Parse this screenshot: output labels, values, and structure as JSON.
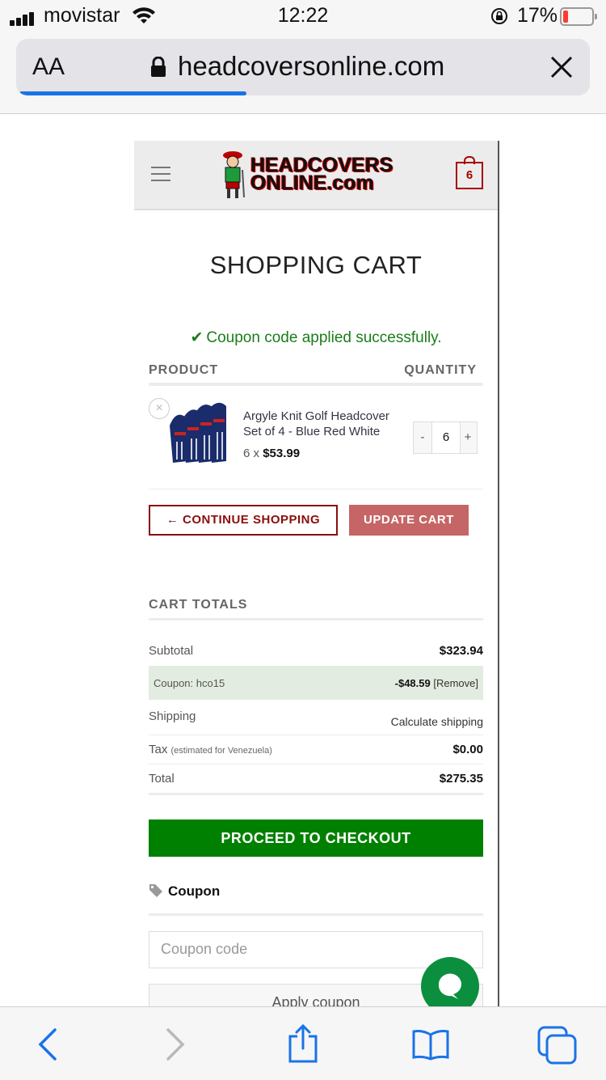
{
  "status_bar": {
    "carrier": "movistar",
    "time": "12:22",
    "battery_percent": "17%"
  },
  "browser": {
    "text_size_label": "AA",
    "url": "headcoversonline.com",
    "load_progress": 0.4
  },
  "site": {
    "logo_line1": "HEADCOVERS",
    "logo_line2": "ONLINE.com",
    "cart_count": "6"
  },
  "cart": {
    "title": "SHOPPING CART",
    "notice": "Coupon code applied successfully.",
    "col_product": "PRODUCT",
    "col_quantity": "QUANTITY",
    "item": {
      "name": "Argyle Knit Golf Headcover Set of 4 - Blue Red White",
      "qty_prefix": "6 x ",
      "price": "$53.99",
      "quantity": "6",
      "minus": "-",
      "plus": "+"
    },
    "continue_label": "← CONTINUE SHOPPING",
    "update_label": "UPDATE CART"
  },
  "totals": {
    "title": "CART TOTALS",
    "subtotal_label": "Subtotal",
    "subtotal_value": "$323.94",
    "coupon_label": "Coupon: hco15",
    "coupon_value": "-$48.59",
    "coupon_remove": "[Remove]",
    "shipping_label": "Shipping",
    "shipping_value": "Calculate shipping",
    "tax_label": "Tax",
    "tax_note": "(estimated for Venezuela)",
    "tax_value": "$0.00",
    "total_label": "Total",
    "total_value": "$275.35",
    "checkout_label": "PROCEED TO CHECKOUT"
  },
  "coupon": {
    "heading": "Coupon",
    "placeholder": "Coupon code",
    "apply_label": "Apply coupon"
  },
  "colors": {
    "brand_red": "#8b0d0d",
    "checkout_green": "#008000",
    "notice_green": "#1a7d1a",
    "link_blue": "#1a73e8"
  }
}
